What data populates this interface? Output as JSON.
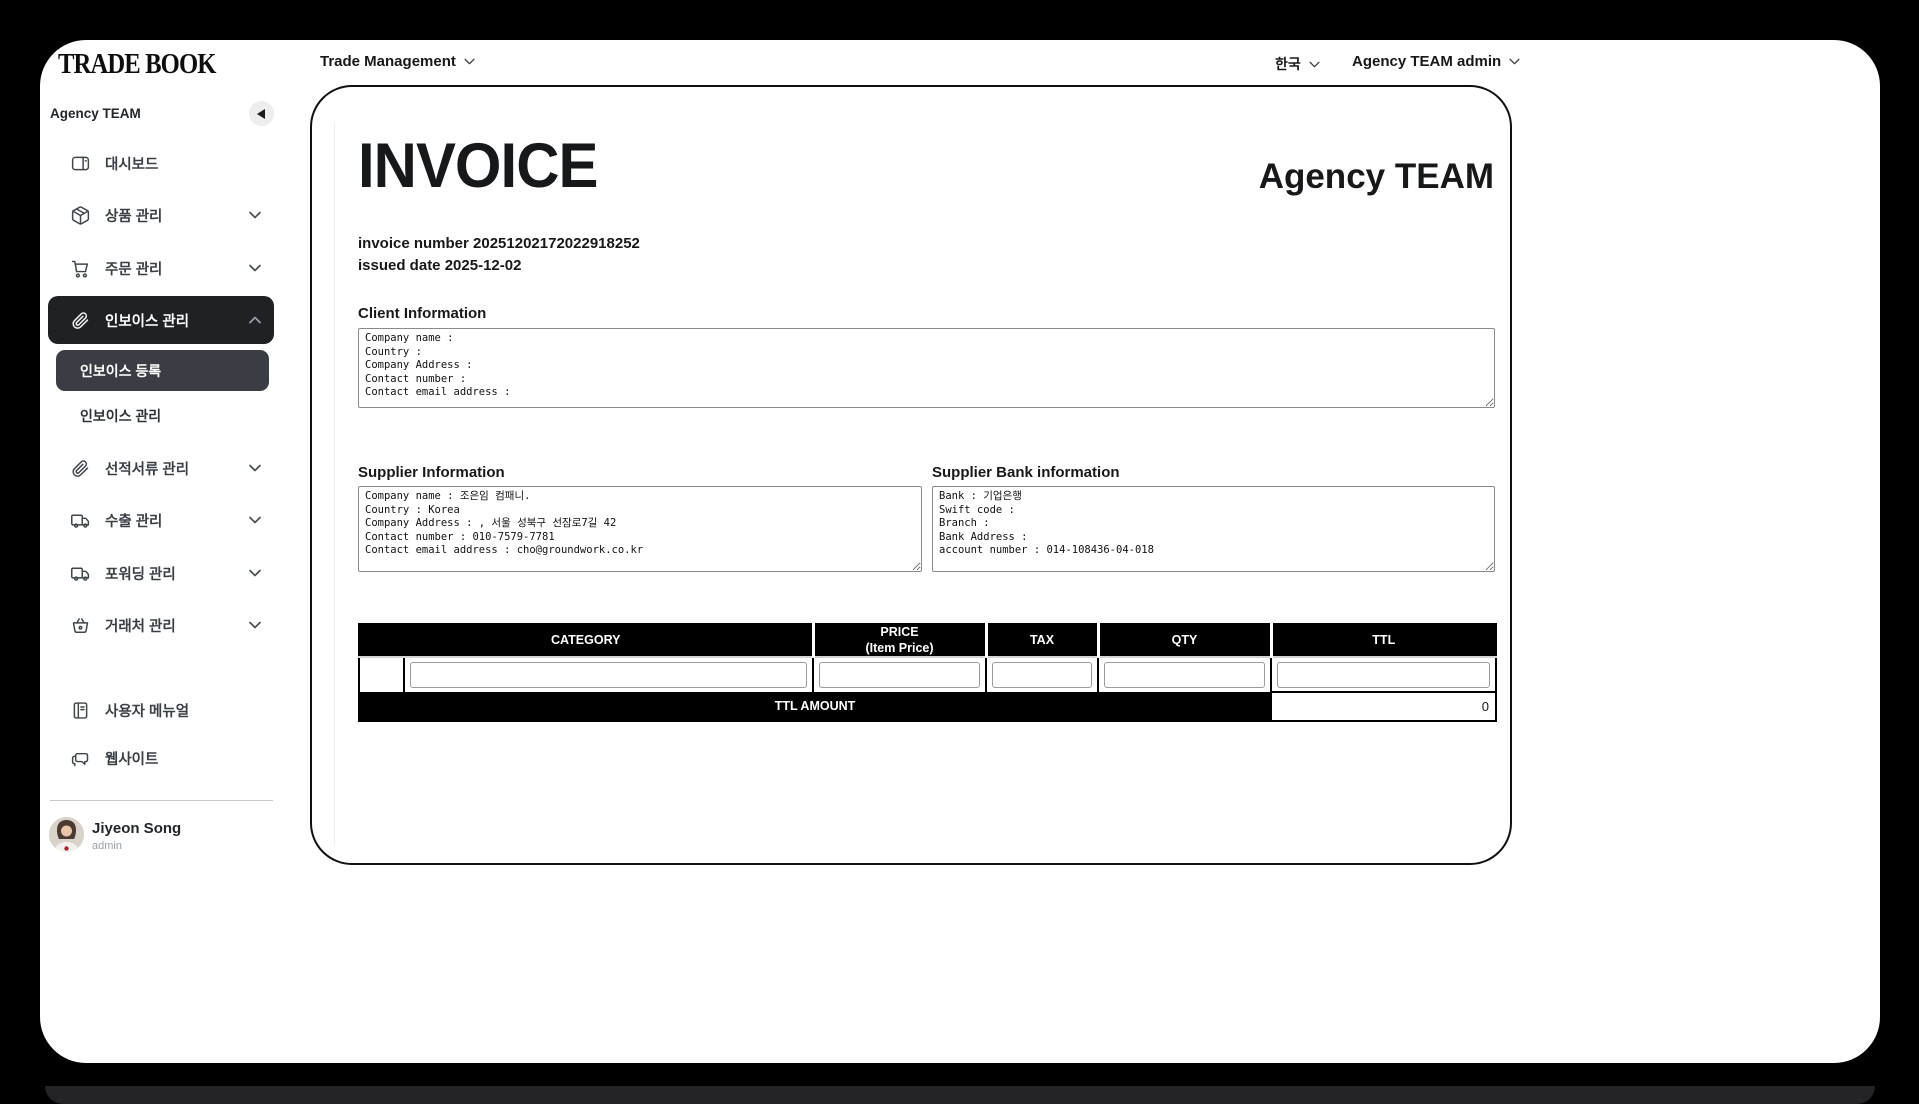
{
  "header": {
    "logo": "TRADE BOOK",
    "nav_dropdown": "Trade Management",
    "language": "한국",
    "account": "Agency TEAM admin"
  },
  "sidebar": {
    "team_label": "Agency TEAM",
    "items": [
      {
        "label": "대시보드",
        "icon": "dashboard"
      },
      {
        "label": "상품 관리",
        "icon": "package"
      },
      {
        "label": "주문 관리",
        "icon": "cart"
      },
      {
        "label": "인보이스 관리",
        "icon": "paperclip"
      },
      {
        "label": "선적서류 관리",
        "icon": "paperclip"
      },
      {
        "label": "수출 관리",
        "icon": "truck"
      },
      {
        "label": "포워딩 관리",
        "icon": "truck"
      },
      {
        "label": "거래처 관리",
        "icon": "basket"
      },
      {
        "label": "사용자 메뉴얼",
        "icon": "manual"
      },
      {
        "label": "웹사이트",
        "icon": "website"
      }
    ],
    "submenu": [
      {
        "label": "인보이스 등록"
      },
      {
        "label": "인보이스 관리"
      }
    ],
    "profile": {
      "name": "Jiyeon Song",
      "role": "admin"
    }
  },
  "invoice": {
    "title": "INVOICE",
    "company": "Agency TEAM",
    "number_label": "invoice number",
    "number": "20251202172022918252",
    "date_label": "issued date",
    "date": "2025-12-02",
    "client_section": {
      "heading": "Client Information",
      "value": "Company name : \nCountry : \nCompany Address : \nContact number : \nContact email address : "
    },
    "supplier_section": {
      "heading": "Supplier Information",
      "value": "Company name : 조은임 컴패니.\nCountry : Korea\nCompany Address : , 서울 성북구 선잠로7길 42\nContact number : 010-7579-7781\nContact email address : cho@groundwork.co.kr"
    },
    "bank_section": {
      "heading": "Supplier Bank information",
      "value": "Bank : 기업은행\nSwift code : \nBranch : \nBank Address : \naccount number : 014-108436-04-018"
    },
    "table": {
      "headers": [
        "CATEGORY",
        "PRICE\n(Item Price)",
        "TAX",
        "QTY",
        "TTL"
      ],
      "ttl_amount_label": "TTL AMOUNT",
      "ttl_amount_value": "0"
    }
  },
  "colors": {
    "active_item_bg": "#202125",
    "selected_sub_bg": "#3a3d43",
    "table_header_bg": "#000000"
  }
}
